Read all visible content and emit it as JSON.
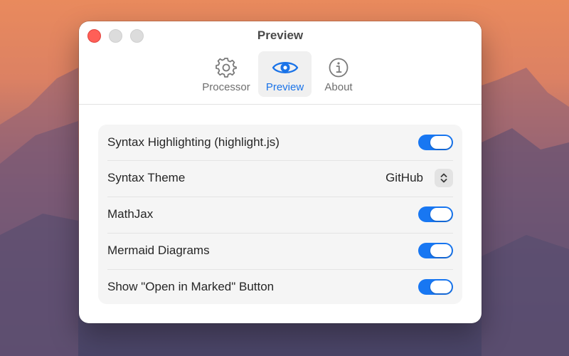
{
  "window": {
    "title": "Preview"
  },
  "toolbar": {
    "tabs": [
      {
        "label": "Processor",
        "icon": "gear-icon",
        "active": false
      },
      {
        "label": "Preview",
        "icon": "eye-icon",
        "active": true
      },
      {
        "label": "About",
        "icon": "info-icon",
        "active": false
      }
    ]
  },
  "settings": {
    "syntax_highlighting": {
      "label": "Syntax Highlighting (highlight.js)",
      "on": true
    },
    "syntax_theme": {
      "label": "Syntax Theme",
      "value": "GitHub"
    },
    "mathjax": {
      "label": "MathJax",
      "on": true
    },
    "mermaid": {
      "label": "Mermaid Diagrams",
      "on": true
    },
    "open_in_marked": {
      "label": "Show \"Open in Marked\" Button",
      "on": true
    }
  },
  "colors": {
    "accent": "#1877f2",
    "close_button": "#ff5f57"
  }
}
